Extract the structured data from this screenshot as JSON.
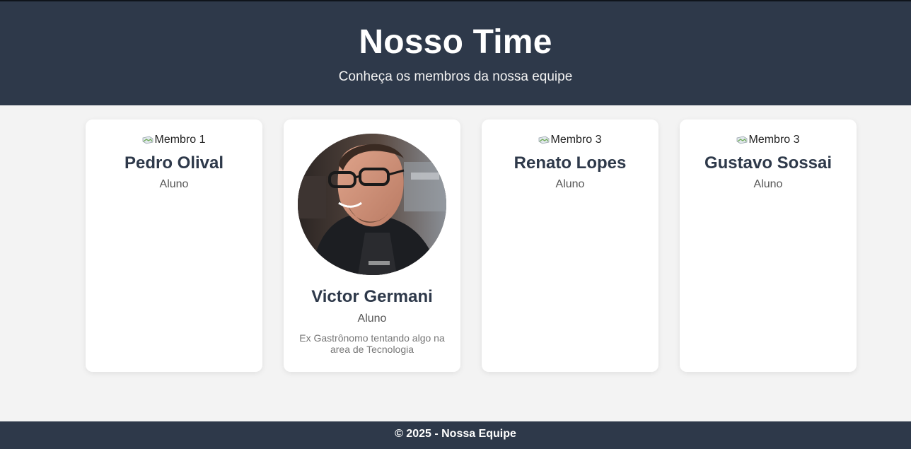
{
  "header": {
    "title": "Nosso Time",
    "subtitle": "Conheça os membros da nossa equipe"
  },
  "members": [
    {
      "image_alt": "Membro 1",
      "name": "Pedro Olival",
      "role": "Aluno",
      "bio": ""
    },
    {
      "image_alt": "Victor Germani",
      "name": "Victor Germani",
      "role": "Aluno",
      "bio": "Ex Gastrônomo tentando algo na area de Tecnologia"
    },
    {
      "image_alt": "Membro 3",
      "name": "Renato Lopes",
      "role": "Aluno",
      "bio": ""
    },
    {
      "image_alt": "Membro 3",
      "name": "Gustavo Sossai",
      "role": "Aluno",
      "bio": ""
    }
  ],
  "footer": {
    "text": "© 2025 - Nossa Equipe"
  },
  "colors": {
    "header_bg": "#2e394a",
    "page_bg": "#f3f3f3",
    "card_bg": "#ffffff",
    "name_color": "#2e394a"
  }
}
